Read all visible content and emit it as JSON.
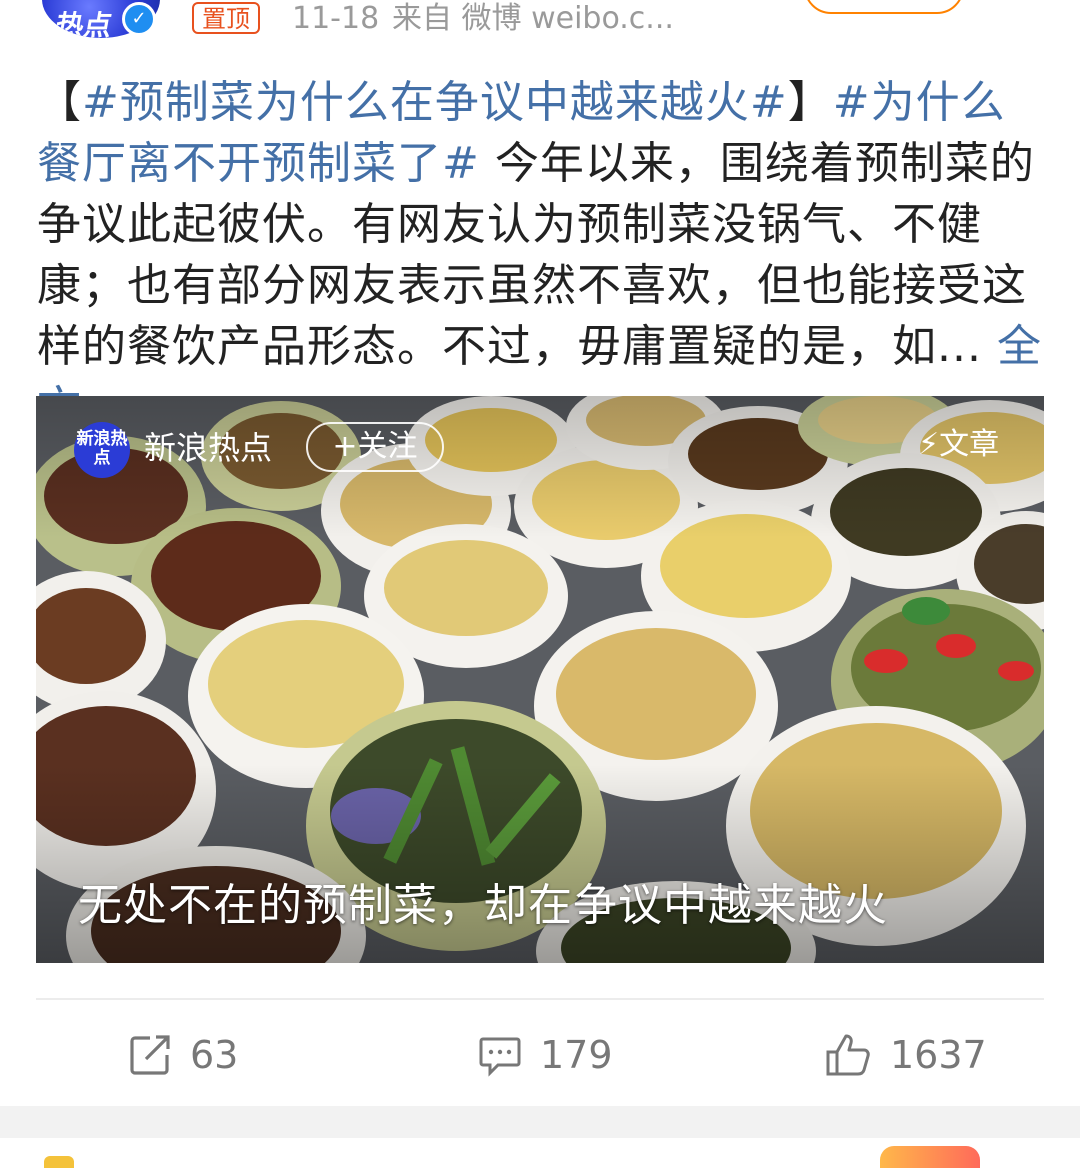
{
  "header": {
    "avatar_text": "热点",
    "pin_label": "置顶",
    "date": "11-18",
    "source": "来自 微博 weibo.c..."
  },
  "post": {
    "tag1": "#预制菜为什么在争议中越来越火#",
    "bracket_open": "【",
    "bracket_close": "】",
    "tag2": "#为什么餐厅离不开预制菜了#",
    "body": " 今年以来，围绕着预制菜的争议此起彼伏。有网友认为预制菜没锅气、不健康；也有部分网友表示虽然不喜欢，但也能接受这样的餐饮产品形态。不过，毋庸置疑的是，如...",
    "full_text_link": " 全文"
  },
  "media": {
    "logo_text": "新浪热点",
    "account_name": "新浪热点",
    "follow_label": "+关注",
    "type_label": "⚡文章",
    "caption": "无处不在的预制菜，却在争议中越来越火"
  },
  "actions": {
    "repost_count": "63",
    "comment_count": "179",
    "like_count": "1637"
  },
  "colors": {
    "link": "#4470a7",
    "pin": "#e8511e",
    "meta": "#9a9a9a"
  }
}
